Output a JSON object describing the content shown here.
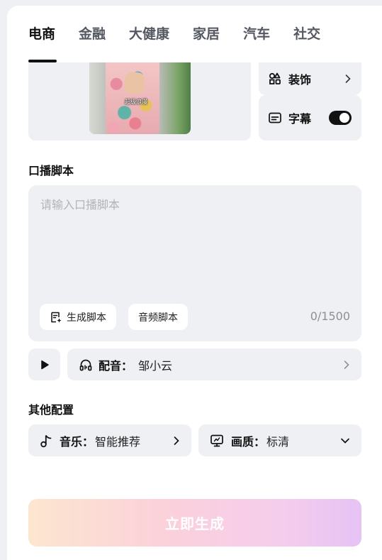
{
  "tabs": [
    {
      "label": "电商",
      "active": true
    },
    {
      "label": "金融",
      "active": false
    },
    {
      "label": "大健康",
      "active": false
    },
    {
      "label": "家居",
      "active": false
    },
    {
      "label": "汽车",
      "active": false
    },
    {
      "label": "社交",
      "active": false
    }
  ],
  "preview": {
    "caption": "超级浪漫"
  },
  "side": {
    "decor_label": "装饰",
    "subtitle_label": "字幕",
    "subtitle_on": true
  },
  "script": {
    "section_title": "口播脚本",
    "placeholder": "请输入口播脚本",
    "generate_chip": "生成脚本",
    "audio_chip": "音频脚本",
    "counter": "0/1500"
  },
  "dubbing": {
    "key": "配音：",
    "value": "邹小云"
  },
  "other": {
    "section_title": "其他配置",
    "music_key": "音乐：",
    "music_value": "智能推荐",
    "quality_key": "画质：",
    "quality_value": "标清"
  },
  "generate_button": "立即生成",
  "colors": {
    "accent": "#111111",
    "card": "#eff0f3",
    "page": "#eef0f4"
  }
}
